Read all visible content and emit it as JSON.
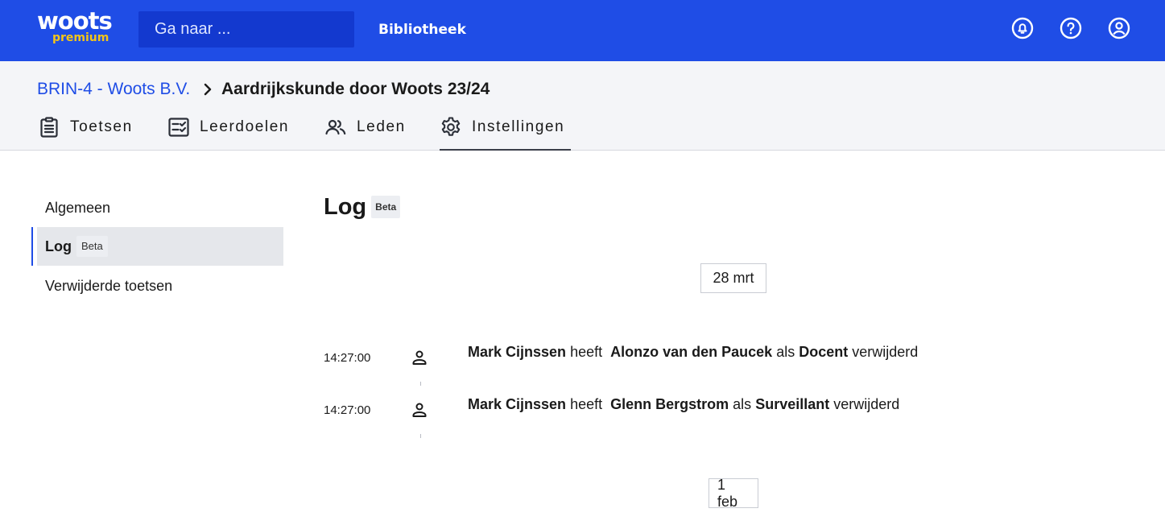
{
  "header": {
    "logo_main": "woots",
    "logo_sub": "premium",
    "search_placeholder": "Ga naar ...",
    "library_label": "Bibliotheek",
    "icons": [
      "notification-bell-icon",
      "help-icon",
      "account-icon"
    ]
  },
  "breadcrumb": {
    "parent": "BRIN-4 - Woots B.V.",
    "current": "Aardrijkskunde door Woots 23/24"
  },
  "tabs": [
    {
      "label": "Toetsen",
      "icon": "clipboard-icon"
    },
    {
      "label": "Leerdoelen",
      "icon": "checklist-icon"
    },
    {
      "label": "Leden",
      "icon": "users-icon"
    },
    {
      "label": "Instellingen",
      "icon": "gear-icon",
      "active": true
    }
  ],
  "sidebar": {
    "items": [
      {
        "label": "Algemeen"
      },
      {
        "label": "Log",
        "badge": "Beta",
        "active": true
      },
      {
        "label": "Verwijderde toetsen"
      }
    ]
  },
  "main": {
    "title": "Log",
    "title_badge": "Beta",
    "groups": [
      {
        "date": "28 mrt",
        "entries": [
          {
            "time": "14:27:00",
            "actor": "Mark Cijnssen",
            "verb": "heeft",
            "subject": "Alonzo van den Paucek",
            "as": "als",
            "role": "Docent",
            "action": "verwijderd"
          },
          {
            "time": "14:27:00",
            "actor": "Mark Cijnssen",
            "verb": "heeft",
            "subject": "Glenn Bergstrom",
            "as": "als",
            "role": "Surveillant",
            "action": "verwijderd"
          }
        ]
      },
      {
        "date": "1 feb",
        "entries": []
      }
    ]
  },
  "colors": {
    "brand_blue": "#1f4de6",
    "logo_accent": "#f5c518",
    "subheader_bg": "#f4f5f8"
  }
}
